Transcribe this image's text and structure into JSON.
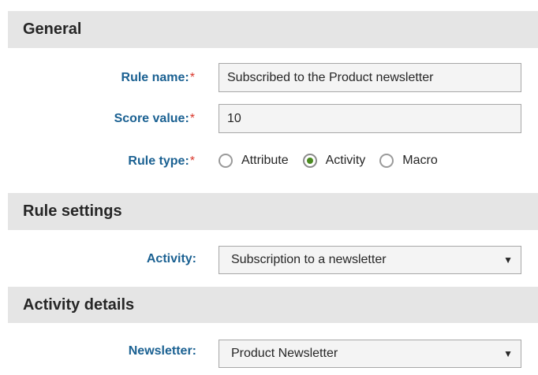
{
  "sections": {
    "general": {
      "title": "General"
    },
    "rule_settings": {
      "title": "Rule settings"
    },
    "activity_details": {
      "title": "Activity details"
    }
  },
  "fields": {
    "rule_name": {
      "label": "Rule name:",
      "required": "*",
      "value": "Subscribed to the Product newsletter"
    },
    "score_value": {
      "label": "Score value:",
      "required": "*",
      "value": "10"
    },
    "rule_type": {
      "label": "Rule type:",
      "required": "*",
      "options": [
        "Attribute",
        "Activity",
        "Macro"
      ],
      "selected": "Activity"
    },
    "activity": {
      "label": "Activity:",
      "value": "Subscription to a newsletter"
    },
    "newsletter": {
      "label": "Newsletter:",
      "value": "Product Newsletter"
    }
  },
  "icons": {
    "dropdown": "caret-down-icon",
    "radio_checked_color": "#4b8a20"
  },
  "colors": {
    "label": "#1b6192",
    "required": "#d9362b",
    "section_bg": "#e5e5e5"
  }
}
